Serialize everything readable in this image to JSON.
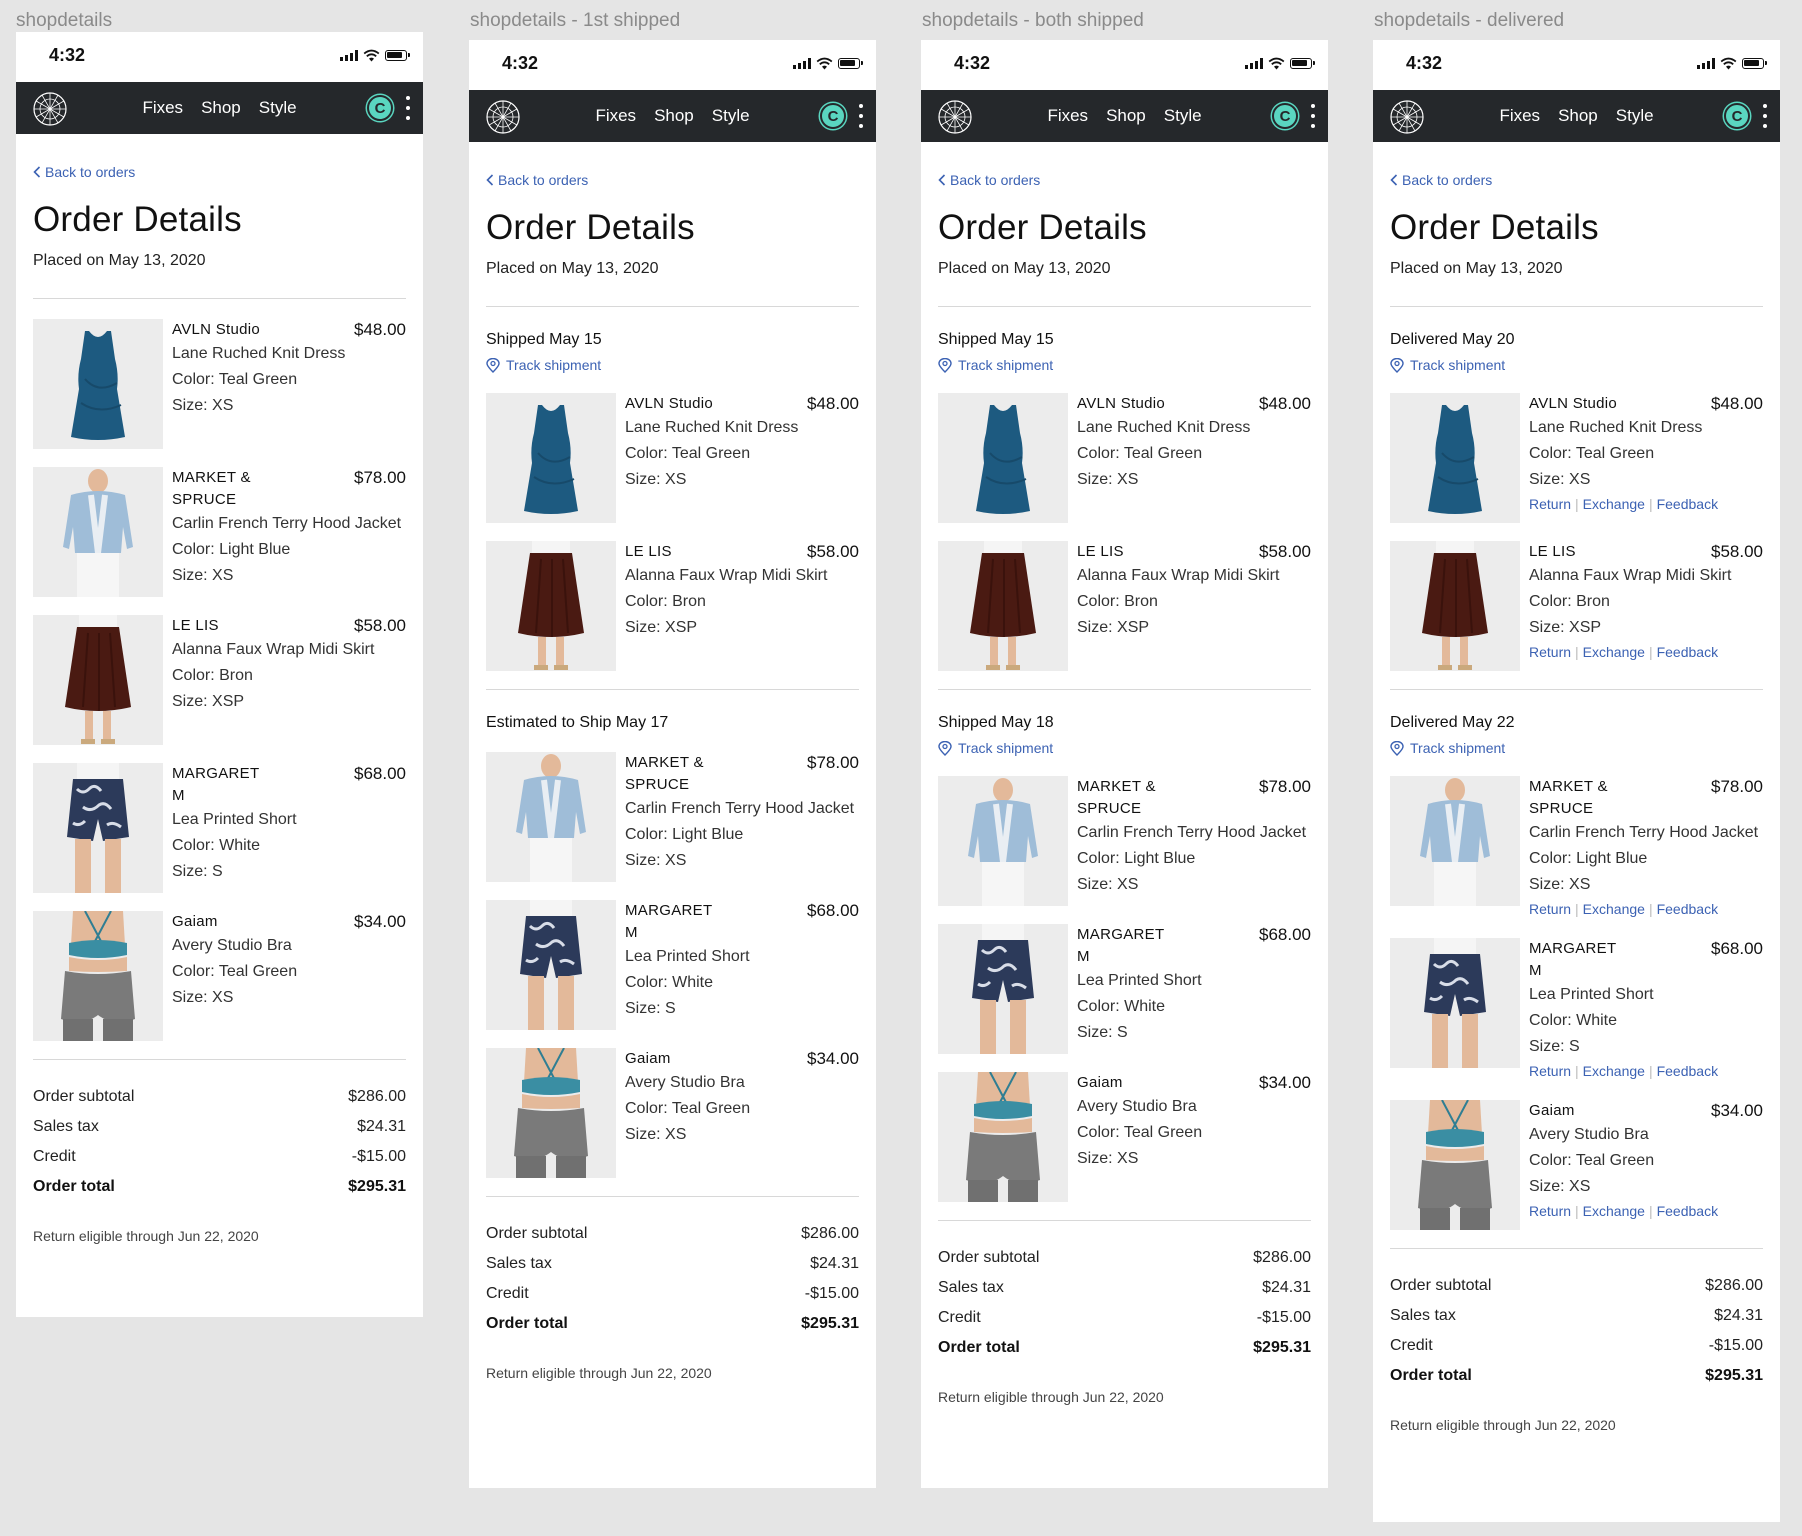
{
  "frames": [
    {
      "label": "shopdetails",
      "groups": [
        {
          "title": "",
          "track": false,
          "actions": false,
          "items": [
            0,
            1,
            2,
            3,
            4
          ]
        }
      ]
    },
    {
      "label": "shopdetails - 1st shipped",
      "groups": [
        {
          "title": "Shipped May 15",
          "track": true,
          "actions": false,
          "items": [
            0,
            2
          ]
        },
        {
          "title": "Estimated to Ship May 17",
          "track": false,
          "actions": false,
          "items": [
            1,
            3,
            4
          ]
        }
      ]
    },
    {
      "label": "shopdetails - both shipped",
      "groups": [
        {
          "title": "Shipped May 15",
          "track": true,
          "actions": false,
          "items": [
            0,
            2
          ]
        },
        {
          "title": "Shipped May 18",
          "track": true,
          "actions": false,
          "items": [
            1,
            3,
            4
          ]
        }
      ]
    },
    {
      "label": "shopdetails - delivered",
      "groups": [
        {
          "title": "Delivered May 20",
          "track": true,
          "actions": true,
          "items": [
            0,
            2
          ]
        },
        {
          "title": "Delivered May 22",
          "track": true,
          "actions": true,
          "items": [
            1,
            3,
            4
          ]
        }
      ]
    }
  ],
  "status": {
    "time": "4:32"
  },
  "nav": {
    "links": [
      "Fixes",
      "Shop",
      "Style"
    ],
    "avatar_initial": "C"
  },
  "page": {
    "back": "Back to orders",
    "title": "Order Details",
    "placed": "Placed on May 13, 2020",
    "track_label": "Track shipment",
    "actions": [
      "Return",
      "Exchange",
      "Feedback"
    ],
    "eligible": "Return eligible through Jun 22, 2020"
  },
  "products": [
    {
      "brand": "AVLN Studio",
      "price": "$48.00",
      "name": "Lane Ruched Knit Dress",
      "color": "Color: Teal Green",
      "size": "Size: XS",
      "icon": "dress-image"
    },
    {
      "brand": "MARKET & SPRUCE",
      "price": "$78.00",
      "name": "Carlin French Terry Hood Jacket",
      "color": "Color: Light Blue",
      "size": "Size: XS",
      "icon": "jacket-image"
    },
    {
      "brand": "LE LIS",
      "price": "$58.00",
      "name": "Alanna Faux Wrap Midi Skirt",
      "color": "Color: Bron",
      "size": "Size: XSP",
      "icon": "skirt-image"
    },
    {
      "brand": "MARGARET M",
      "price": "$68.00",
      "name": "Lea Printed Short",
      "color": "Color: White",
      "size": "Size: S",
      "icon": "shorts-image"
    },
    {
      "brand": "Gaiam",
      "price": "$34.00",
      "name": "Avery Studio Bra",
      "color": "Color: Teal Green",
      "size": "Size: XS",
      "icon": "bra-image"
    }
  ],
  "totals": [
    {
      "label": "Order subtotal",
      "value": "$286.00",
      "bold": false
    },
    {
      "label": "Sales tax",
      "value": "$24.31",
      "bold": false
    },
    {
      "label": "Credit",
      "value": "-$15.00",
      "bold": false
    },
    {
      "label": "Order total",
      "value": "$295.31",
      "bold": true
    }
  ],
  "colors": {
    "nav_bg": "#25282b",
    "link": "#3c62b3",
    "avatar": "#5ad6c0",
    "dress": "#1d5a80",
    "skirt": "#4a1a12",
    "denim": "#9fbdd8"
  }
}
